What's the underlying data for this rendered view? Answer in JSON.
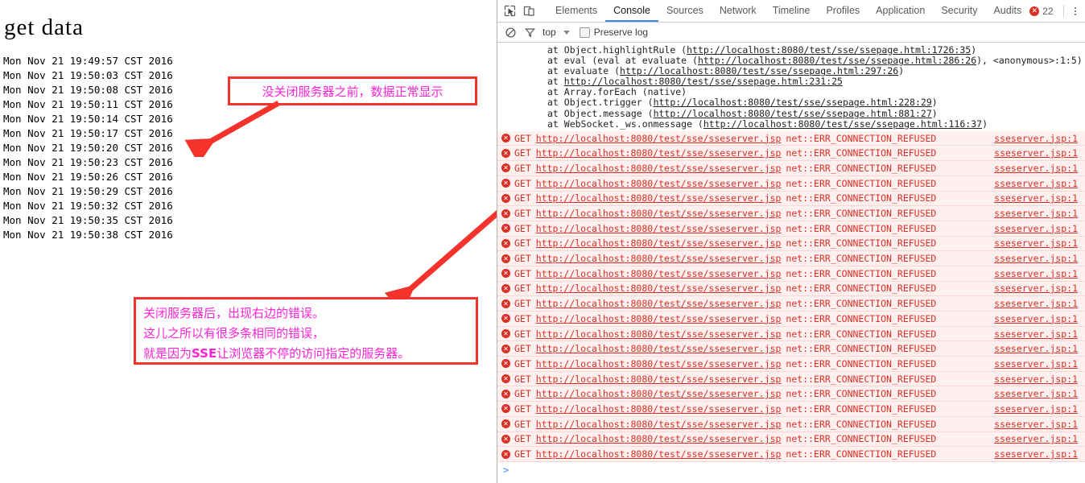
{
  "left_page": {
    "title": "get data",
    "timestamps": [
      "Mon Nov 21 19:49:57 CST 2016",
      "Mon Nov 21 19:50:03 CST 2016",
      "Mon Nov 21 19:50:08 CST 2016",
      "Mon Nov 21 19:50:11 CST 2016",
      "Mon Nov 21 19:50:14 CST 2016",
      "Mon Nov 21 19:50:17 CST 2016",
      "Mon Nov 21 19:50:20 CST 2016",
      "Mon Nov 21 19:50:23 CST 2016",
      "Mon Nov 21 19:50:26 CST 2016",
      "Mon Nov 21 19:50:29 CST 2016",
      "Mon Nov 21 19:50:32 CST 2016",
      "Mon Nov 21 19:50:35 CST 2016",
      "Mon Nov 21 19:50:38 CST 2016"
    ],
    "annotation_top": "没关闭服务器之前，数据正常显示",
    "annotation_bottom": {
      "line1": "关闭服务器后，出现右边的错误。",
      "line2": "这儿之所以有很多条相同的错误，",
      "line3_pre": "就是因为",
      "line3_em": "SSE",
      "line3_post": "让浏览器不停的访问指定的服务器。"
    },
    "annotation_border_color": "#f5322b",
    "annotation_text_color": "#ff23d6",
    "arrow_color": "#f5322b"
  },
  "devtools": {
    "tools": [
      {
        "name": "inspect-element-icon"
      },
      {
        "name": "device-toolbar-icon"
      }
    ],
    "tabs": [
      {
        "label": "Elements",
        "active": false
      },
      {
        "label": "Console",
        "active": true
      },
      {
        "label": "Sources",
        "active": false
      },
      {
        "label": "Network",
        "active": false
      },
      {
        "label": "Timeline",
        "active": false
      },
      {
        "label": "Profiles",
        "active": false
      },
      {
        "label": "Application",
        "active": false
      },
      {
        "label": "Security",
        "active": false
      },
      {
        "label": "Audits",
        "active": false
      }
    ],
    "error_badge_count": "22",
    "error_badge_color": "#d93025",
    "active_tab_underline_color": "#4285f4",
    "filter_bar": {
      "clear_icon": "clear-console-icon",
      "filter_icon": "filter-funnel-icon",
      "context_label": "top",
      "preserve_log_label": "Preserve log",
      "preserve_log_checked": false
    },
    "stack_trace": [
      {
        "prefix": "at Object.highlightRule (",
        "link": "http://localhost:8080/test/sse/ssepage.html:1726:35",
        "suffix": ")"
      },
      {
        "prefix": "at eval (eval at evaluate (",
        "link": "http://localhost:8080/test/sse/ssepage.html:286:26",
        "suffix": "), <anonymous>:1:5)"
      },
      {
        "prefix": "at evaluate (",
        "link": "http://localhost:8080/test/sse/ssepage.html:297:26",
        "suffix": ")"
      },
      {
        "prefix": "at ",
        "link": "http://localhost:8080/test/sse/ssepage.html:231:25",
        "suffix": ""
      },
      {
        "prefix": "at Array.forEach (native)",
        "link": "",
        "suffix": ""
      },
      {
        "prefix": "at Object.trigger (",
        "link": "http://localhost:8080/test/sse/ssepage.html:228:29",
        "suffix": ")"
      },
      {
        "prefix": "at Object.message (",
        "link": "http://localhost:8080/test/sse/ssepage.html:881:27",
        "suffix": ")"
      },
      {
        "prefix": "at WebSocket._ws.onmessage (",
        "link": "http://localhost:8080/test/sse/ssepage.html:116:37",
        "suffix": ")"
      }
    ],
    "error_row_template": {
      "method": "GET",
      "url": "http://localhost:8080/test/sse/sseserver.jsp",
      "message": "net::ERR_CONNECTION_REFUSED",
      "source": "sseserver.jsp:1"
    },
    "error_row_count": 22,
    "prompt_symbol": ">"
  }
}
